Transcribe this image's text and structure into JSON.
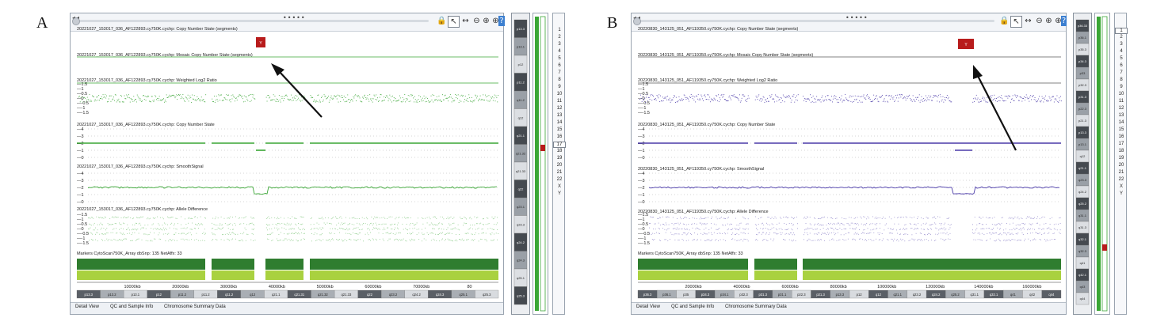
{
  "panels": [
    {
      "letter": "A",
      "accent": "#3aa635",
      "tracks": {
        "cn_segments": "20221027_153017_036_AF122893.cy750K.cychp: Copy Number State (segments)",
        "mosaic_segments": "20221027_153017_036_AF122893.cy750K.cychp: Mosaic Copy Number State (segments)",
        "log2": "20221027_153017_036_AF122893.cy750K.cychp: Weighted Log2 Ratio",
        "cn_state": "20221027_153017_036_AF122893.cy750K.cychp: Copy Number State",
        "smooth": "20221027_153017_036_AF122893.cy750K.cychp: SmoothSignal",
        "allele": "20221027_153017_036_AF122893.cy750K.cychp: Allele Difference",
        "markers": "Markers CytoScan750K_Array dbSnp: 135 NetAffx: 33"
      },
      "log2_ticks": [
        "1.5",
        "1",
        "0.5",
        "0",
        "-0.5",
        "-1",
        "-1.5"
      ],
      "cn_ticks": [
        "4",
        "3",
        "2",
        "1",
        "0"
      ],
      "allele_ticks": [
        "1.5",
        "1",
        "0.5",
        "0",
        "-0.5",
        "-1",
        "-1.5"
      ],
      "segment_label": "Y",
      "axis_labels": [
        "10000kb",
        "20000kb",
        "30000kb",
        "40000kb",
        "50000kb",
        "60000kb",
        "70000kb",
        "80"
      ],
      "bands": [
        "p13.3",
        "p13.2",
        "p13.1",
        "p12",
        "p11.2",
        "p11.2",
        "q11.2",
        "q12",
        "q21.1",
        "q21.31",
        "q21.32",
        "q21.33",
        "q22",
        "q23.2",
        "q24.2",
        "q24.3",
        "q25.1",
        "q25.3"
      ],
      "vertical_bands": [
        "p13.3",
        "p13.1",
        "p12",
        "p11.2",
        "q11.2",
        "q12",
        "q21.1",
        "q21.32",
        "q21.33",
        "q22",
        "q23.1",
        "q23.3",
        "q24.2",
        "q24.3",
        "q25.1",
        "q25.3"
      ],
      "tabs": [
        "Detail View",
        "QC and Sample Info",
        "Chromosome Summary Data"
      ]
    },
    {
      "letter": "B",
      "accent": "#4a3aa8",
      "tracks": {
        "cn_segments": "20220830_143125_051_AF119350.cy750K.cychp: Copy Number State (segments)",
        "mosaic_segments": "20220830_143125_051_AF119350.cy750K.cychp: Mosaic Copy Number State (segments)",
        "log2": "20220830_143125_051_AF119350.cy750K.cychp: Weighted Log2 Ratio",
        "cn_state": "20220830_143125_051_AF119350.cy750K.cychp: Copy Number State",
        "smooth": "20220830_143125_051_AF119350.cy750K.cychp: SmoothSignal",
        "allele": "20220830_143125_051_AF119350.cy750K.cychp: Allele Difference",
        "markers": "Markers CytoScan750K_Array dbSnp: 135 NetAffx: 33"
      },
      "log2_ticks": [
        "1.5",
        "1",
        "0.5",
        "0",
        "-0.5",
        "-1",
        "-1.5"
      ],
      "cn_ticks": [
        "4",
        "3",
        "2",
        "1",
        "0"
      ],
      "allele_ticks": [
        "1.5",
        "1",
        "0.5",
        "0",
        "-0.5",
        "-1",
        "-1.5"
      ],
      "segment_label": "Y",
      "axis_labels": [
        "20000kb",
        "40000kb",
        "60000kb",
        "80000kb",
        "100000kb",
        "120000kb",
        "140000kb",
        "160000kb"
      ],
      "bands": [
        "p36.3",
        "p36.1",
        "p35",
        "p34.3",
        "p34.1",
        "p32.3",
        "p31.3",
        "p31.1",
        "p22.3",
        "p21.3",
        "p13.3",
        "p12",
        "q12",
        "q21.1",
        "q23.2",
        "q24.2",
        "q25.2",
        "q31.1",
        "q32.1",
        "q41",
        "q42",
        "q44"
      ],
      "vertical_bands": [
        "p36.33",
        "p36.1",
        "p35.3",
        "p34.3",
        "p33",
        "p32.3",
        "p31.3",
        "p22.3",
        "p21.3",
        "p13.3",
        "p13.1",
        "q12",
        "q21.1",
        "q23.3",
        "q24.2",
        "q25.2",
        "q31.1",
        "q31.3",
        "q32.1",
        "q32.3",
        "q41",
        "q42.1",
        "q43",
        "q44"
      ],
      "tabs": [
        "Detail View",
        "QC and Sample Info",
        "Chromosome Summary Data"
      ]
    }
  ],
  "chromosome_list": [
    "1",
    "2",
    "3",
    "4",
    "5",
    "6",
    "7",
    "8",
    "9",
    "10",
    "11",
    "12",
    "13",
    "14",
    "15",
    "16",
    "17",
    "18",
    "19",
    "20",
    "21",
    "22",
    "X",
    "Y"
  ],
  "selected_chromosome_a": "17",
  "selected_chromosome_b": "1",
  "segment_color": "#b81c1c"
}
